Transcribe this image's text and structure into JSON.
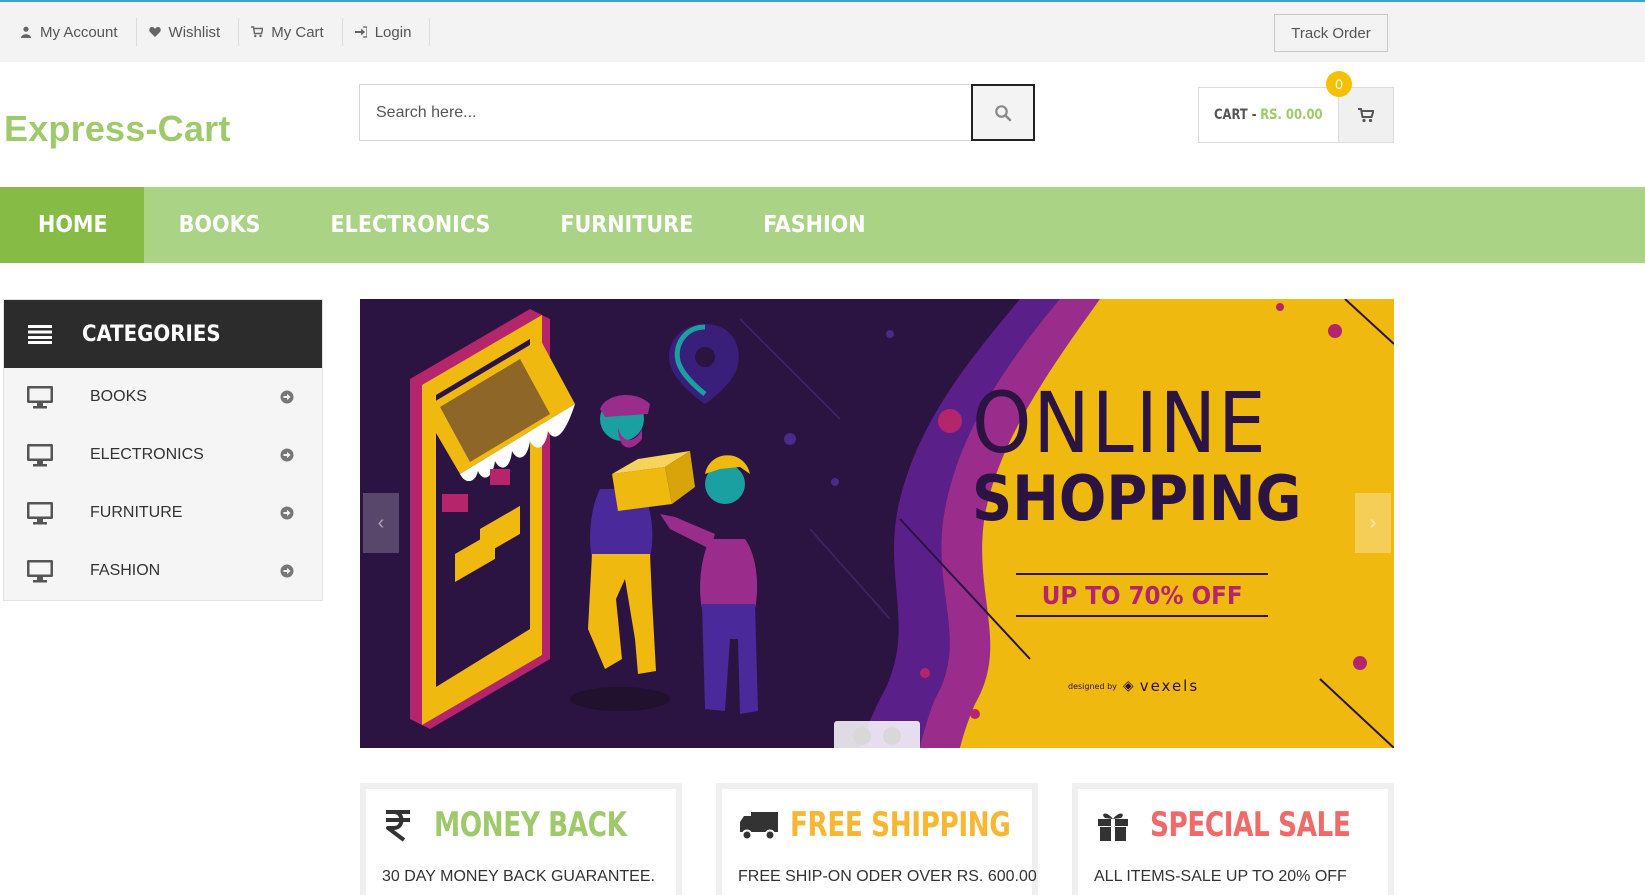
{
  "topbar": {
    "links": [
      {
        "label": "My Account",
        "icon": "user-icon"
      },
      {
        "label": "Wishlist",
        "icon": "heart-icon"
      },
      {
        "label": "My Cart",
        "icon": "cart-icon"
      },
      {
        "label": "Login",
        "icon": "sign-in-icon"
      }
    ],
    "track_order": "Track Order"
  },
  "header": {
    "logo": "Express-Cart",
    "search_placeholder": "Search here...",
    "cart_label": "CART -",
    "cart_amount": "RS. 00.00",
    "cart_count": "0"
  },
  "nav": {
    "items": [
      "HOME",
      "BOOKS",
      "ELECTRONICS",
      "FURNITURE",
      "FASHION"
    ],
    "active": "HOME"
  },
  "categories": {
    "title": "CATEGORIES",
    "items": [
      "BOOKS",
      "ELECTRONICS",
      "FURNITURE",
      "FASHION"
    ]
  },
  "banner": {
    "headline_1": "ONLINE",
    "headline_2": "SHOPPING",
    "offer": "UP TO 70% OFF",
    "credit": "designed by",
    "credit_brand": "vexels",
    "slide_count": 2
  },
  "features": [
    {
      "title": "MONEY BACK",
      "subtitle": "30 DAY MONEY BACK GUARANTEE.",
      "icon": "rupee-icon",
      "color": "#9fca6b"
    },
    {
      "title": "FREE SHIPPING",
      "subtitle": "FREE SHIP-ON ODER OVER RS. 600.00",
      "icon": "truck-icon",
      "color": "#f7b733"
    },
    {
      "title": "SPECIAL SALE",
      "subtitle": "ALL ITEMS-SALE UP TO 20% OFF",
      "icon": "gift-icon",
      "color": "#f06a6a"
    }
  ],
  "colors": {
    "accent_green": "#9fca6b",
    "nav_green": "#abd385",
    "nav_active": "#86bc45",
    "badge_yellow": "#f5c000",
    "banner_yellow": "#efb90f",
    "banner_purple": "#2b1342"
  }
}
